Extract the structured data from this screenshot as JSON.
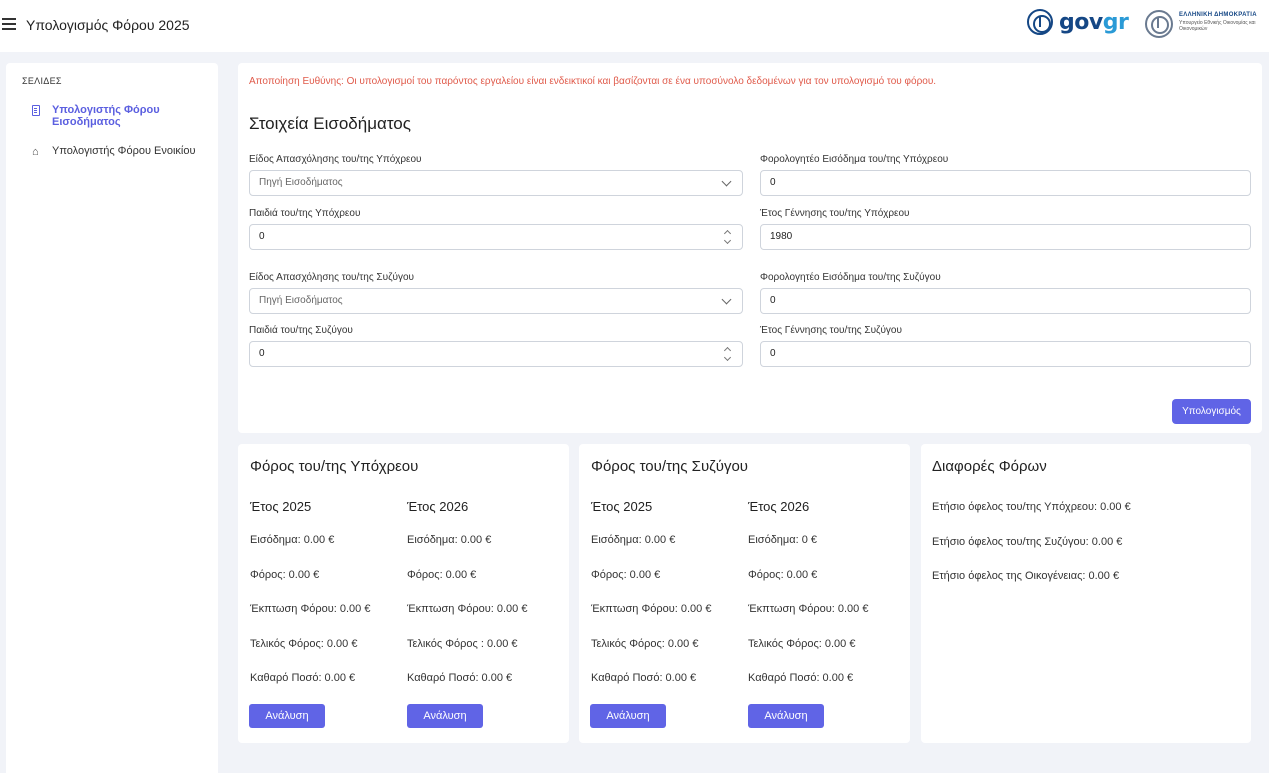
{
  "header": {
    "title": "Υπολογισμός Φόρου 2025",
    "logo_gov": "gov",
    "logo_gr": "gr",
    "ministry_line1": "ΕΛΛΗΝΙΚΗ ΔΗΜΟΚΡΑΤΙΑ",
    "ministry_line2": "Υπουργείο Εθνικής Οικονομίας και Οικονομικών"
  },
  "sidebar": {
    "title": "ΣΕΛΙΔΕΣ",
    "items": [
      {
        "label": "Υπολογιστής Φόρου Εισοδήματος",
        "icon": "document-icon",
        "active": true
      },
      {
        "label": "Υπολογιστής Φόρου Ενοικίου",
        "icon": "home-icon",
        "active": false
      }
    ]
  },
  "form": {
    "disclaimer": "Αποποίηση Ευθύνης: Οι υπολογισμοί του παρόντος εργαλείου είναι ενδεικτικοί και βασίζονται σε ένα υποσύνολο δεδομένων για τον υπολογισμό του φόρου.",
    "section_title": "Στοιχεία Εισοδήματος",
    "taxpayer_employment_label": "Είδος Απασχόλησης του/της Υπόχρεου",
    "taxpayer_employment_value": "Πηγή Εισοδήματος",
    "taxpayer_income_label": "Φορολογητέο Εισόδημα του/της Υπόχρεου",
    "taxpayer_income_value": "0",
    "taxpayer_children_label": "Παιδιά του/της Υπόχρεου",
    "taxpayer_children_value": "0",
    "taxpayer_birth_year_label": "Έτος Γέννησης του/της Υπόχρεου",
    "taxpayer_birth_year_value": "1980",
    "spouse_employment_label": "Είδος Απασχόλησης του/της Συζύγου",
    "spouse_employment_value": "Πηγή Εισοδήματος",
    "spouse_income_label": "Φορολογητέο Εισόδημα του/της Συζύγου",
    "spouse_income_value": "0",
    "spouse_children_label": "Παιδιά του/της Συζύγου",
    "spouse_children_value": "0",
    "spouse_birth_year_label": "Έτος Γέννησης του/της Συζύγου",
    "spouse_birth_year_value": "0",
    "calculate_label": "Υπολογισμός"
  },
  "taxpayer_card": {
    "title": "Φόρος του/της Υπόχρεου",
    "y2025": {
      "heading": "Έτος 2025",
      "income": "Εισόδημα: 0.00 €",
      "tax": "Φόρος: 0.00 €",
      "discount": "Έκπτωση Φόρου: 0.00 €",
      "final": "Τελικός Φόρος: 0.00 €",
      "net": "Καθαρό Ποσό: 0.00 €",
      "button": "Ανάλυση"
    },
    "y2026": {
      "heading": "Έτος 2026",
      "income": "Εισόδημα: 0.00 €",
      "tax": "Φόρος: 0.00 €",
      "discount": "Έκπτωση Φόρου: 0.00 €",
      "final": "Τελικός Φόρος : 0.00 €",
      "net": "Καθαρό Ποσό: 0.00 €",
      "button": "Ανάλυση"
    }
  },
  "spouse_card": {
    "title": "Φόρος του/της Συζύγου",
    "y2025": {
      "heading": "Έτος 2025",
      "income": "Εισόδημα: 0.00 €",
      "tax": "Φόρος: 0.00 €",
      "discount": "Έκπτωση Φόρου: 0.00 €",
      "final": "Τελικός Φόρος: 0.00 €",
      "net": "Καθαρό Ποσό: 0.00 €",
      "button": "Ανάλυση"
    },
    "y2026": {
      "heading": "Έτος 2026",
      "income": "Εισόδημα: 0 €",
      "tax": "Φόρος: 0.00 €",
      "discount": "Έκπτωση Φόρου: 0.00 €",
      "final": "Τελικός Φόρος: 0.00 €",
      "net": "Καθαρό Ποσό: 0.00 €",
      "button": "Ανάλυση"
    }
  },
  "diff_card": {
    "title": "Διαφορές Φόρων",
    "taxpayer_benefit": "Ετήσιο όφελος του/της Υπόχρεου: 0.00 €",
    "spouse_benefit": "Ετήσιο όφελος του/της Συζύγου: 0.00 €",
    "family_benefit": "Ετήσιο όφελος της Οικογένειας: 0.00 €"
  },
  "colors": {
    "accent": "#6064e6",
    "disclaimer": "#e05a4a",
    "gov_blue": "#154785"
  }
}
